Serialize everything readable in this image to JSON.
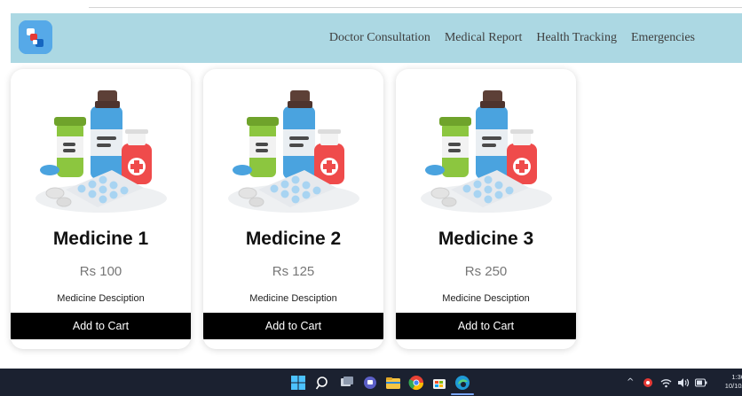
{
  "navbar": {
    "links": [
      "Doctor Consultation",
      "Medical Report",
      "Health Tracking",
      "Emergencies"
    ],
    "color": "#acd8e3"
  },
  "products": [
    {
      "name": "Medicine 1",
      "price": "Rs 100",
      "description": "Medicine Desciption",
      "button": "Add to Cart"
    },
    {
      "name": "Medicine 2",
      "price": "Rs 125",
      "description": "Medicine Desciption",
      "button": "Add to Cart"
    },
    {
      "name": "Medicine 3",
      "price": "Rs 250",
      "description": "Medicine Desciption",
      "button": "Add to Cart"
    }
  ],
  "taskbar": {
    "icons": [
      "windows-start-icon",
      "search-icon",
      "task-view-icon",
      "teams-chat-icon",
      "file-explorer-icon",
      "chrome-icon",
      "store-icon",
      "edge-icon"
    ],
    "tray_icons": [
      "chevron-up-icon",
      "antivirus-icon",
      "wifi-icon",
      "volume-icon",
      "battery-icon"
    ],
    "time": "1:36 P",
    "date": "10/10/20"
  }
}
